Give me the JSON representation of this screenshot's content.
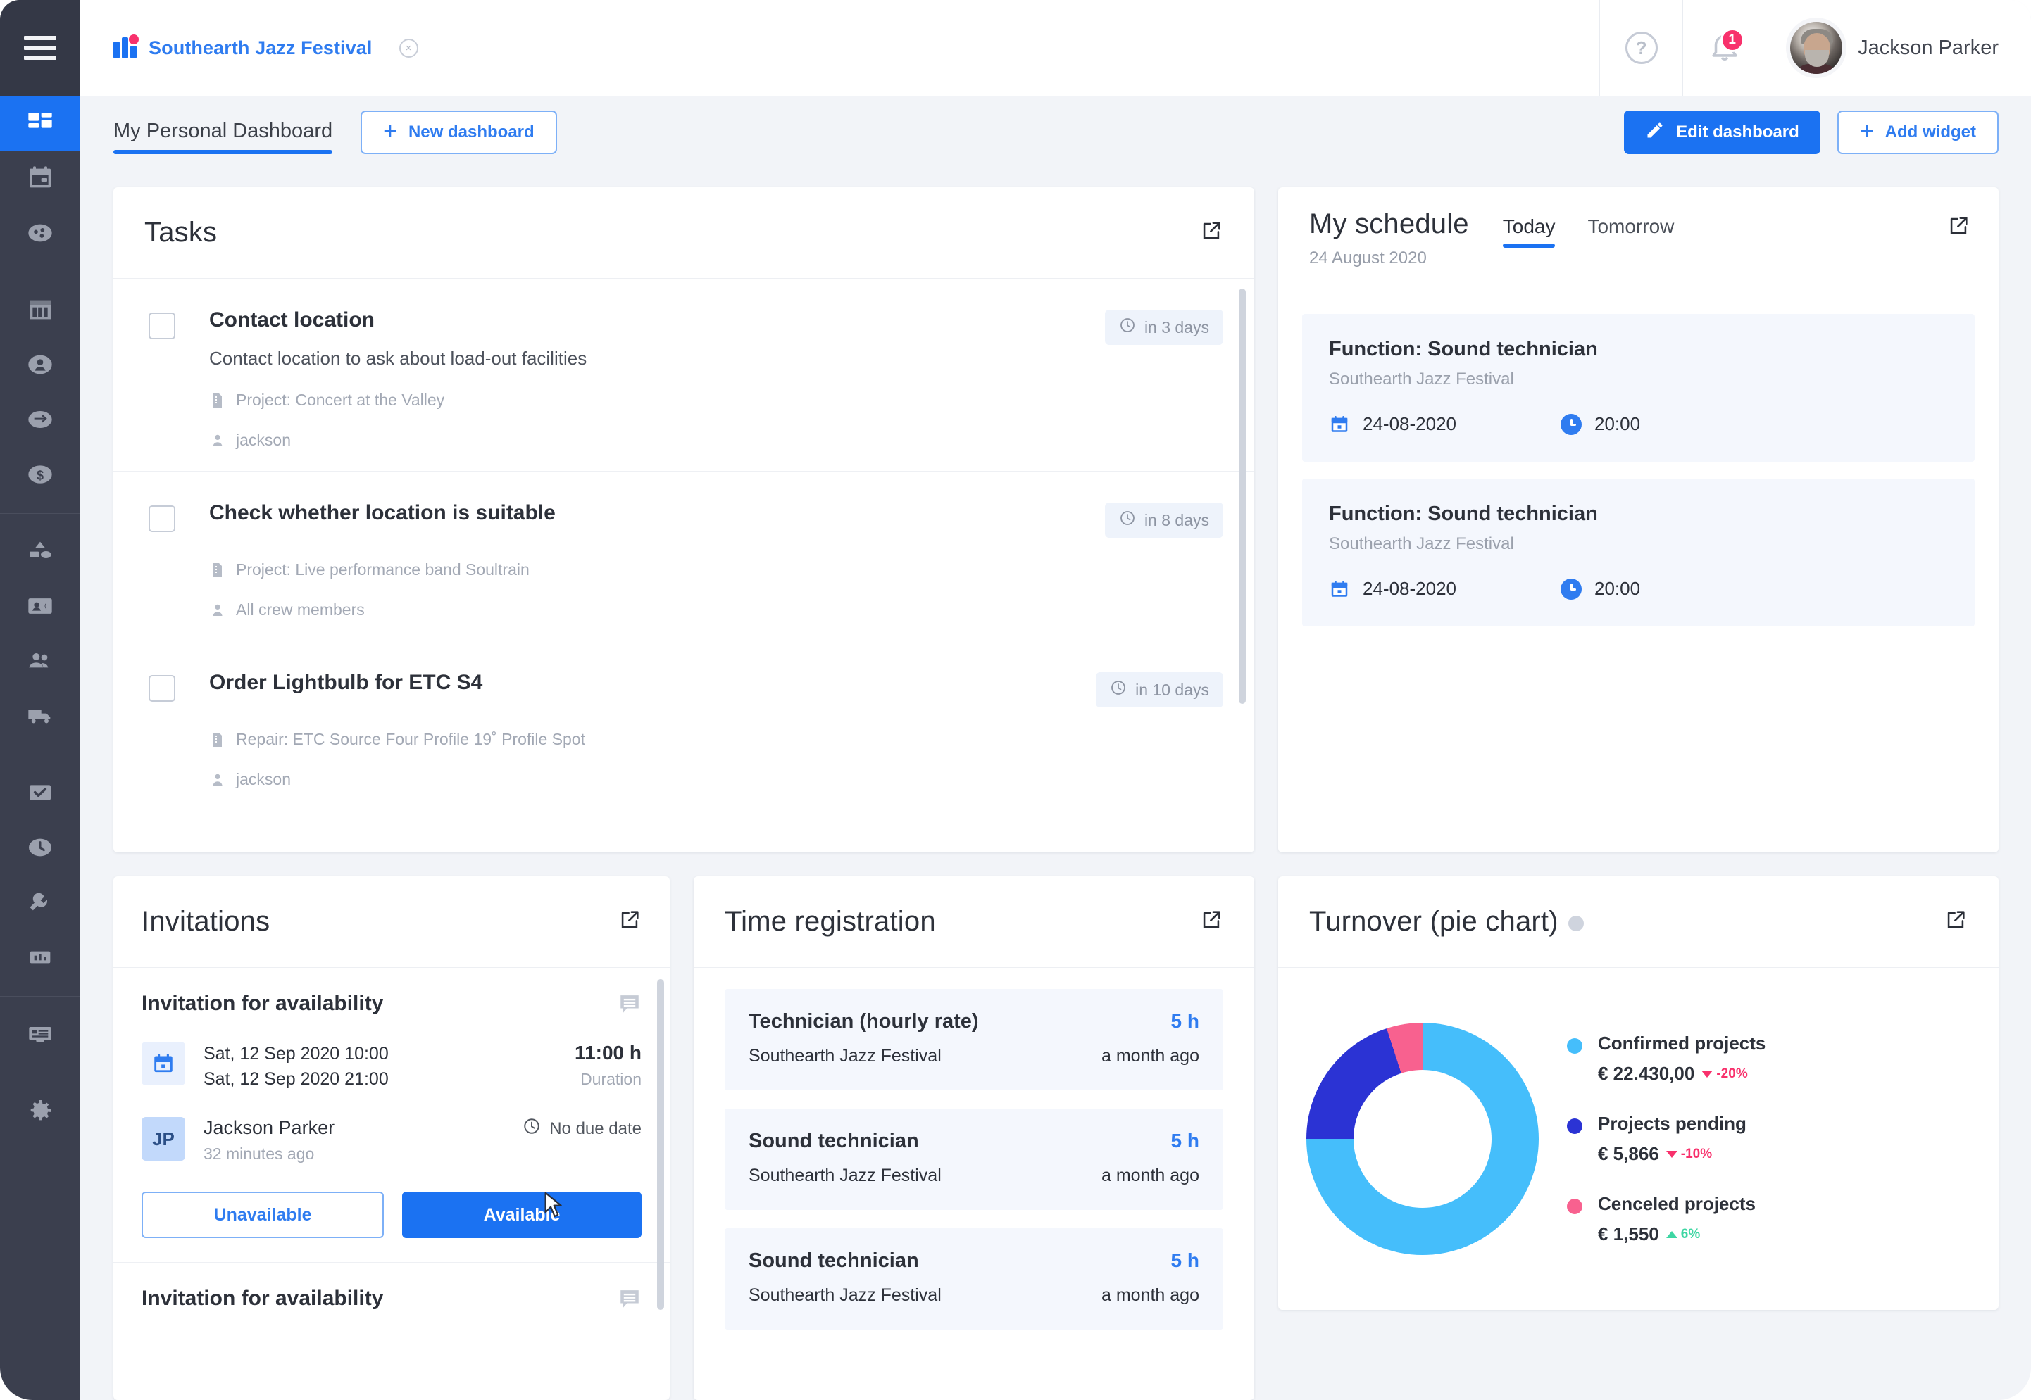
{
  "colors": {
    "accent": "#1b72f2",
    "accent_light": "#2f7cf0",
    "sidebar_bg": "#3b3f4e",
    "page_bg": "#f2f4f8",
    "pink": "#f8316c",
    "green": "#3ed6a3",
    "pie_light_blue": "#45befb",
    "pie_dark_blue": "#2b33d4",
    "pie_pink": "#f8618f"
  },
  "sidebar": {
    "menu_label": "menu",
    "items": [
      {
        "icon": "dashboard-icon",
        "label": "Dashboard",
        "active": true
      },
      {
        "icon": "calendar-icon",
        "label": "Calendar",
        "active": false
      },
      {
        "icon": "planning-icon",
        "label": "Planning",
        "active": false
      },
      {
        "icon": "projects-icon",
        "label": "Projects",
        "active": false
      },
      {
        "icon": "contacts-icon",
        "label": "Contacts",
        "active": false
      },
      {
        "icon": "transfer-icon",
        "label": "Transfers",
        "active": false
      },
      {
        "icon": "finance-icon",
        "label": "Finance",
        "active": false
      },
      {
        "icon": "equipment-icon",
        "label": "Equipment",
        "active": false
      },
      {
        "icon": "crew-card-icon",
        "label": "Crew cards",
        "active": false
      },
      {
        "icon": "people-icon",
        "label": "People",
        "active": false
      },
      {
        "icon": "transport-icon",
        "label": "Transport",
        "active": false
      },
      {
        "icon": "tasks-icon",
        "label": "Tasks",
        "active": false
      },
      {
        "icon": "time-icon",
        "label": "Time registration",
        "active": false
      },
      {
        "icon": "wrench-icon",
        "label": "Repairs",
        "active": false
      },
      {
        "icon": "reports-icon",
        "label": "Reports",
        "active": false
      },
      {
        "icon": "news-icon",
        "label": "News",
        "active": false
      },
      {
        "icon": "gear-icon",
        "label": "Settings",
        "active": false
      }
    ]
  },
  "topbar": {
    "brand": "Southearth Jazz Festival",
    "close_label": "×",
    "help_label": "?",
    "notification_count": "1",
    "user_name": "Jackson Parker"
  },
  "dashbar": {
    "tab_label": "My Personal Dashboard",
    "new_dashboard": "New dashboard",
    "edit_dashboard": "Edit dashboard",
    "add_widget": "Add widget",
    "plus": "+"
  },
  "tasks": {
    "title": "Tasks",
    "items": [
      {
        "title": "Contact location",
        "description": "Contact location to ask about load-out facilities",
        "project": "Project: Concert at the Valley",
        "assignee": "jackson",
        "due": "in 3 days"
      },
      {
        "title": "Check whether location is suitable",
        "description": "",
        "project": "Project: Live performance band Soultrain",
        "assignee": "All crew members",
        "due": "in 8 days"
      },
      {
        "title": "Order Lightbulb for ETC S4",
        "description": "",
        "project": "Repair: ETC Source Four Profile 19˚ Profile Spot",
        "assignee": "jackson",
        "due": "in 10 days"
      }
    ]
  },
  "schedule": {
    "title": "My schedule",
    "date": "24 August 2020",
    "tabs": [
      {
        "label": "Today",
        "active": true
      },
      {
        "label": "Tomorrow",
        "active": false
      }
    ],
    "items": [
      {
        "function": "Function: Sound technician",
        "project": "Southearth Jazz Festival",
        "date": "24-08-2020",
        "time": "20:00"
      },
      {
        "function": "Function: Sound technician",
        "project": "Southearth Jazz Festival",
        "date": "24-08-2020",
        "time": "20:00"
      }
    ]
  },
  "invitations": {
    "title": "Invitations",
    "items": [
      {
        "title": "Invitation for availability",
        "start": "Sat, 12 Sep 2020 10:00",
        "end": "Sat, 12 Sep 2020 21:00",
        "duration_value": "11:00 h",
        "duration_label": "Duration",
        "person": "Jackson Parker",
        "person_initials": "JP",
        "person_time": "32 minutes ago",
        "due": "No due date",
        "decline_label": "Unavailable",
        "accept_label": "Available"
      },
      {
        "title": "Invitation for availability"
      }
    ]
  },
  "time_registration": {
    "title": "Time registration",
    "items": [
      {
        "name": "Technician (hourly rate)",
        "hours": "5 h",
        "project": "Southearth Jazz Festival",
        "ago": "a month ago"
      },
      {
        "name": "Sound technician",
        "hours": "5 h",
        "project": "Southearth Jazz Festival",
        "ago": "a month ago"
      },
      {
        "name": "Sound technician",
        "hours": "5 h",
        "project": "Southearth Jazz Festival",
        "ago": "a month ago"
      }
    ]
  },
  "turnover": {
    "title": "Turnover (pie chart)"
  },
  "chart_data": {
    "type": "pie",
    "title": "Turnover (pie chart)",
    "legend_position": "right",
    "labels": [
      "Confirmed projects",
      "Projects pending",
      "Cenceled projects"
    ],
    "value_texts": [
      "€ 22.430,00",
      "€ 5,866",
      "€ 1,550"
    ],
    "values": [
      22430,
      5866,
      1550
    ],
    "percentages": [
      75,
      20,
      5
    ],
    "colors": [
      "#45befb",
      "#2b33d4",
      "#f8618f"
    ],
    "deltas": [
      {
        "text": "-20%",
        "direction": "down"
      },
      {
        "text": "-10%",
        "direction": "down"
      },
      {
        "text": "6%",
        "direction": "up"
      }
    ]
  }
}
